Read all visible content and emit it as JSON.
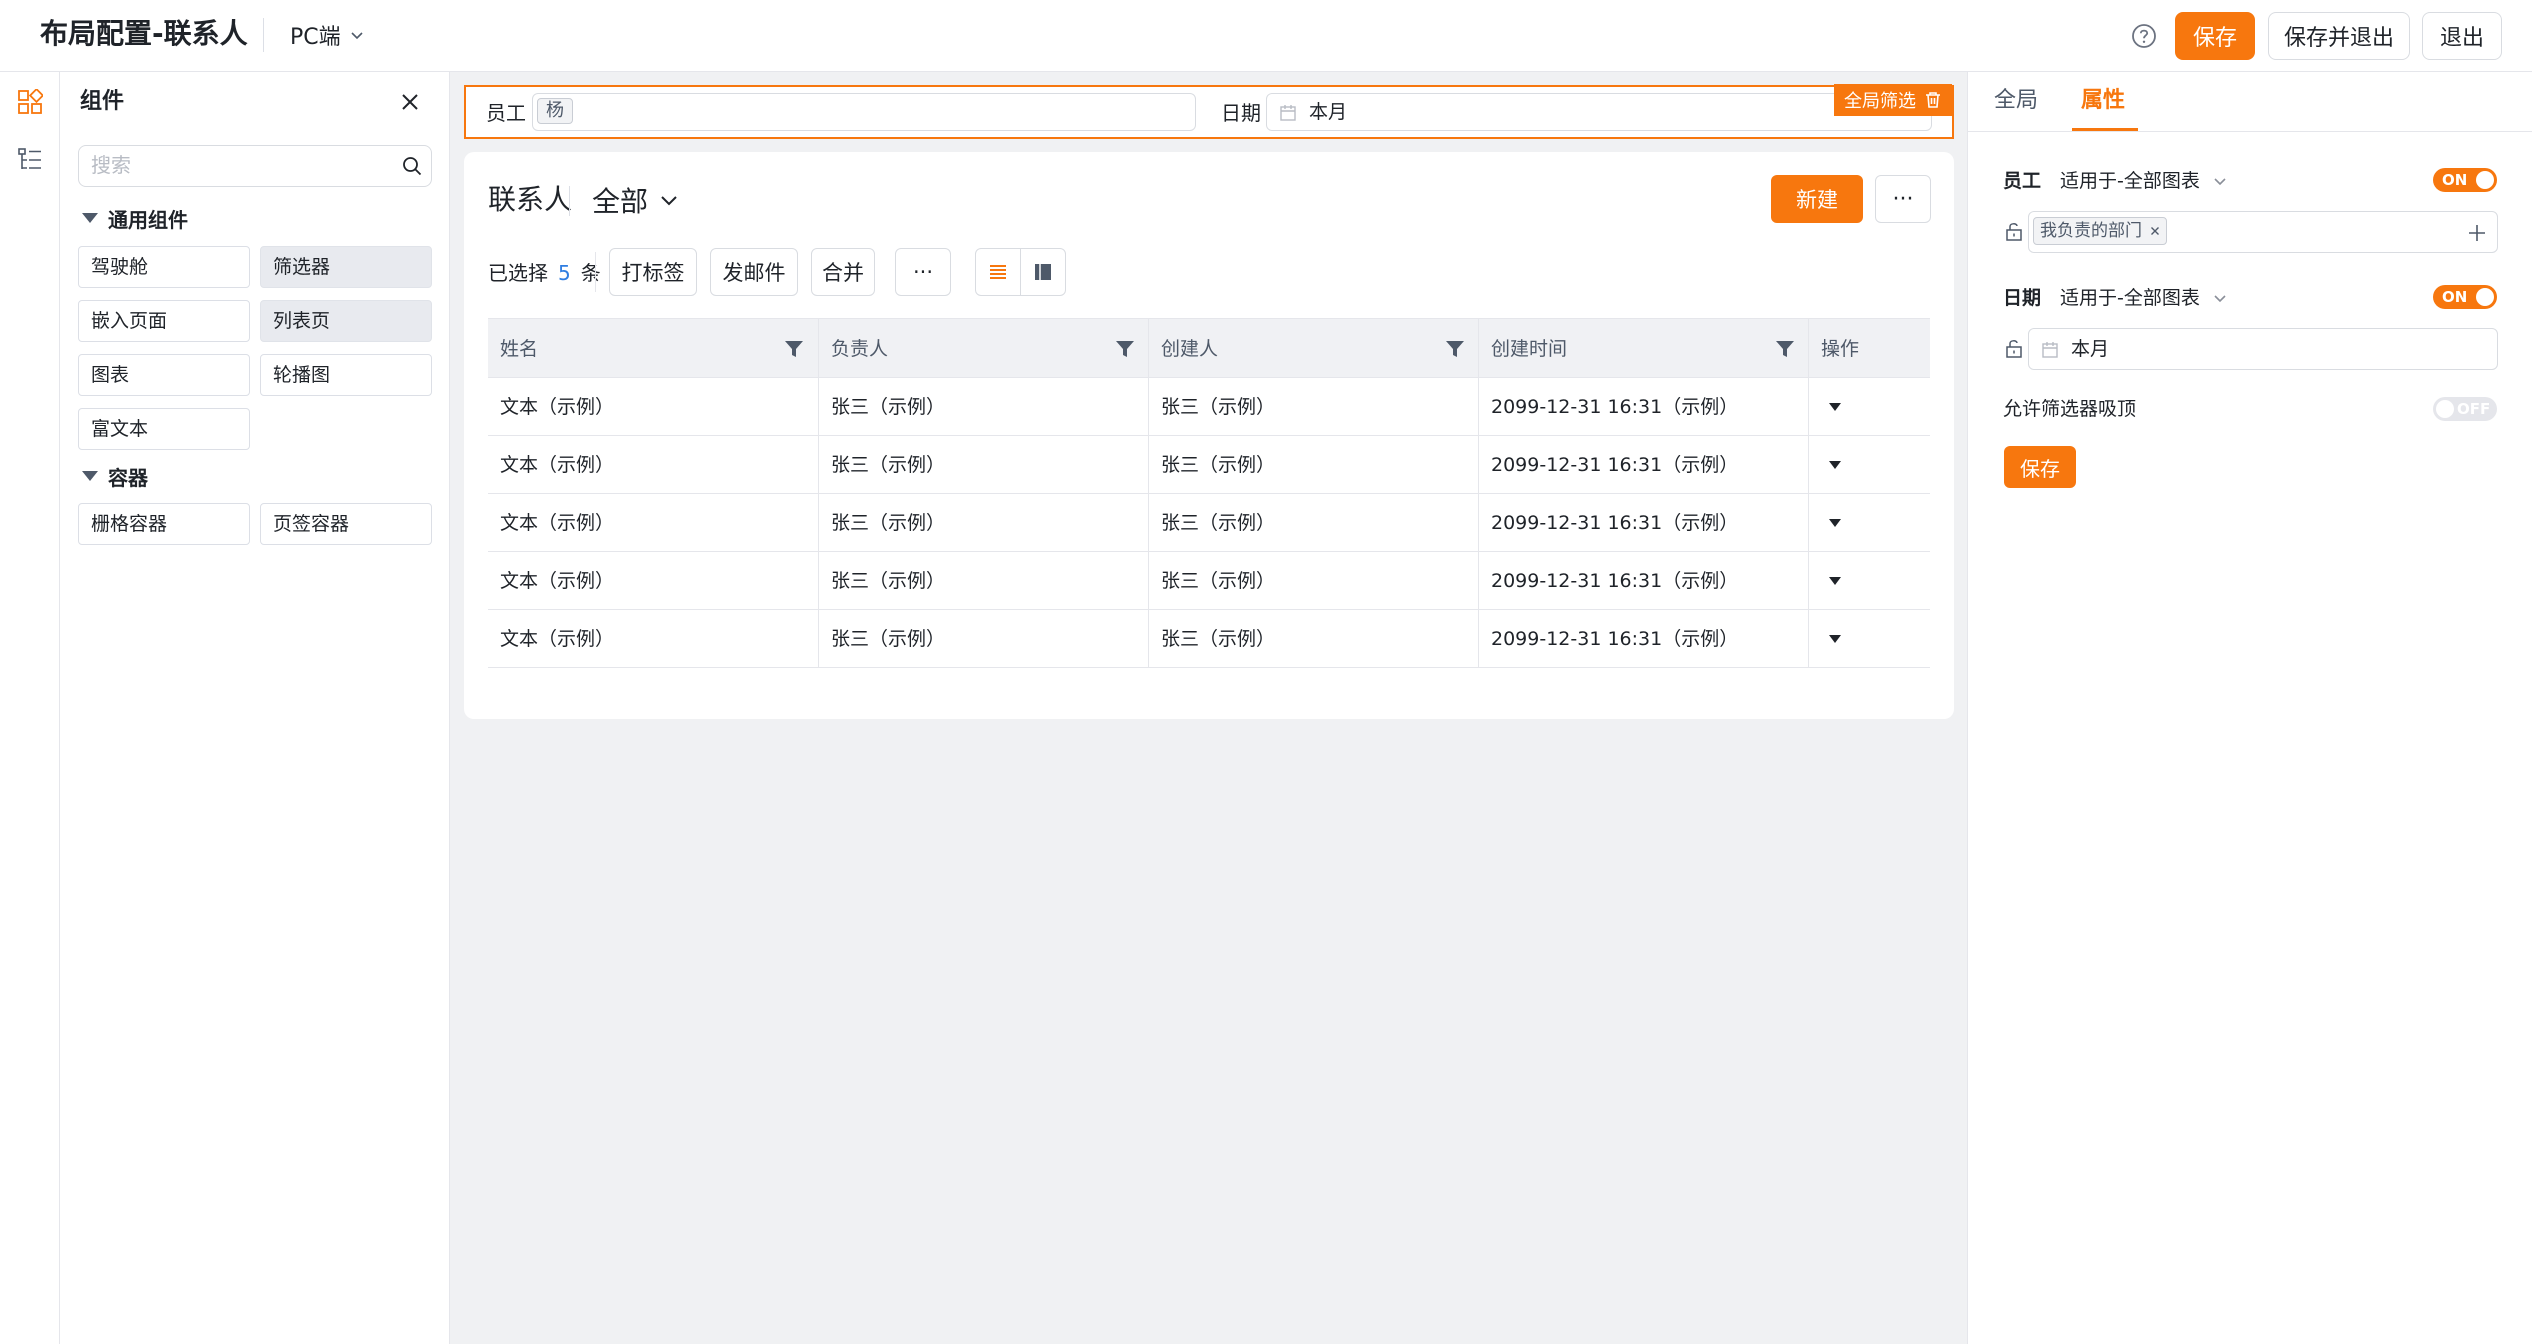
{
  "header": {
    "title": "布局配置-联系人",
    "platform": "PC端",
    "save_label": "保存",
    "save_exit_label": "保存并退出",
    "exit_label": "退出"
  },
  "components_panel": {
    "title": "组件",
    "search_placeholder": "搜索",
    "groups": [
      {
        "label": "通用组件",
        "items": [
          "驾驶舱",
          "筛选器",
          "嵌入页面",
          "列表页",
          "图表",
          "轮播图",
          "富文本"
        ]
      },
      {
        "label": "容器",
        "items": [
          "栅格容器",
          "页签容器"
        ]
      }
    ]
  },
  "filter_bar": {
    "employee_label": "员工",
    "employee_value": "杨",
    "date_label": "日期",
    "date_value": "本月",
    "global_badge": "全局筛选"
  },
  "list_card": {
    "title": "联系人",
    "view": "全部",
    "new_label": "新建",
    "more_label": "···",
    "selected_prefix": "已选择",
    "selected_count": "5",
    "selected_suffix": "条",
    "actions": [
      "打标签",
      "发邮件",
      "合并",
      "···"
    ],
    "table": {
      "columns": [
        "姓名",
        "负责人",
        "创建人",
        "创建时间",
        "操作"
      ],
      "rows": [
        [
          "文本（示例）",
          "张三（示例）",
          "张三（示例）",
          "2099-12-31 16:31（示例）"
        ],
        [
          "文本（示例）",
          "张三（示例）",
          "张三（示例）",
          "2099-12-31 16:31（示例）"
        ],
        [
          "文本（示例）",
          "张三（示例）",
          "张三（示例）",
          "2099-12-31 16:31（示例）"
        ],
        [
          "文本（示例）",
          "张三（示例）",
          "张三（示例）",
          "2099-12-31 16:31（示例）"
        ],
        [
          "文本（示例）",
          "张三（示例）",
          "张三（示例）",
          "2099-12-31 16:31（示例）"
        ]
      ]
    }
  },
  "properties_panel": {
    "tabs": [
      "全局",
      "属性"
    ],
    "active_tab": "属性",
    "employee": {
      "label": "员工",
      "scope": "适用于-全部图表",
      "toggle": "ON",
      "tag": "我负责的部门"
    },
    "date": {
      "label": "日期",
      "scope": "适用于-全部图表",
      "toggle": "ON",
      "value": "本月"
    },
    "allow_pin": {
      "label": "允许筛选器吸顶",
      "toggle": "OFF"
    },
    "save_label": "保存"
  },
  "colors": {
    "accent": "#f7770e",
    "link_blue": "#2f7de1",
    "canvas_bg": "#f0f1f3"
  }
}
